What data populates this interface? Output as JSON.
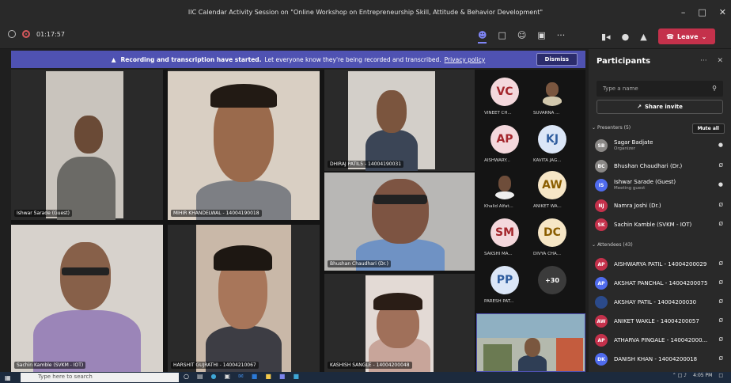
{
  "window": {
    "title": "IIC Calendar Activity Session on \"Online Workshop on Entrepreneurship Skill, Attitude & Behavior Development\""
  },
  "toolbar": {
    "timer": "01:17:57",
    "leave_label": "Leave"
  },
  "banner": {
    "bold_text": "Recording and transcription have started.",
    "text": "Let everyone know they're being recorded and transcribed.",
    "link": "Privacy policy",
    "dismiss_label": "Dismiss"
  },
  "videos": [
    {
      "name": "Ishwar Sarade (Guest)"
    },
    {
      "name": "MIHIR KHANDELWAL - 14004190018"
    },
    {
      "name": "DHIRAJ PATIL5 - 14004190031"
    },
    {
      "name": "Bhushan Chaudhari (Dr.)"
    },
    {
      "name": "Sachin Kamble (SVKM - IOT)"
    },
    {
      "name": "HARSHIT GUJRATHI - 14004210067"
    },
    {
      "name": "KASHISH SANGLE - 14004200048"
    }
  ],
  "avatars": [
    {
      "initials": "VC",
      "label": "VINEET CH...",
      "bg": "#f4d8dc",
      "fg": "#a4262c"
    },
    {
      "initials": "",
      "label": "SUVARNA ...",
      "bg": "#e9e3cf",
      "fg": "#333333"
    },
    {
      "initials": "AP",
      "label": "AISHWARY...",
      "bg": "#f4d8dc",
      "fg": "#a4262c"
    },
    {
      "initials": "KJ",
      "label": "KAVITA JAG...",
      "bg": "#dbe6f7",
      "fg": "#2f5d9e"
    },
    {
      "initials": "",
      "label": "Khalid Alfat...",
      "bg": "#c9c0b3",
      "fg": "#333333"
    },
    {
      "initials": "AW",
      "label": "ANIKET WA...",
      "bg": "#f6e6c6",
      "fg": "#8a5d00"
    },
    {
      "initials": "SM",
      "label": "SAKSHI MA...",
      "bg": "#f4d8dc",
      "fg": "#a4262c"
    },
    {
      "initials": "DC",
      "label": "DIVYA CHA...",
      "bg": "#f6e6c6",
      "fg": "#8a5d00"
    },
    {
      "initials": "PP",
      "label": "PARESH PAT...",
      "bg": "#dbe6f7",
      "fg": "#2f5d9e"
    },
    {
      "initials": "+30",
      "label": "",
      "bg": "#3b3b3b",
      "fg": "#ffffff"
    }
  ],
  "participants": {
    "title": "Participants",
    "search_placeholder": "Type a name",
    "share_invite": "Share invite",
    "presenters_header": "Presenters (5)",
    "mute_all": "Mute all",
    "presenters": [
      {
        "name": "Sagar Badjate",
        "role": "Organizer",
        "initials": "SB",
        "color": "#8a8886"
      },
      {
        "name": "Bhushan Chaudhari (Dr.)",
        "role": "",
        "initials": "BC",
        "color": "#8a8886"
      },
      {
        "name": "Ishwar Sarade (Guest)",
        "role": "Meeting guest",
        "initials": "IS",
        "color": "#4f6bed"
      },
      {
        "name": "Namra Joshi (Dr.)",
        "role": "",
        "initials": "NJ",
        "color": "#c4314b"
      },
      {
        "name": "Sachin Kamble (SVKM - IOT)",
        "role": "",
        "initials": "SK",
        "color": "#c4314b"
      }
    ],
    "attendees_header": "Attendees (43)",
    "attendees": [
      {
        "name": "AISHWARYA PATIL - 14004200029",
        "initials": "AP",
        "color": "#c4314b"
      },
      {
        "name": "AKSHAT PANCHAL - 14004200075",
        "initials": "AP",
        "color": "#4f6bed"
      },
      {
        "name": "AKSHAY PATIL - 14004200030",
        "initials": "",
        "color": "#2b4a8a"
      },
      {
        "name": "ANIKET WAKLE - 14004200057",
        "initials": "AW",
        "color": "#c4314b"
      },
      {
        "name": "ATHARVA PINGALE - 140042000...",
        "initials": "AP",
        "color": "#c4314b"
      },
      {
        "name": "DANISH KHAN - 14004200018",
        "initials": "DK",
        "color": "#4f6bed"
      }
    ]
  },
  "taskbar": {
    "search_placeholder": "Type here to search",
    "time": "4:05 PM"
  }
}
